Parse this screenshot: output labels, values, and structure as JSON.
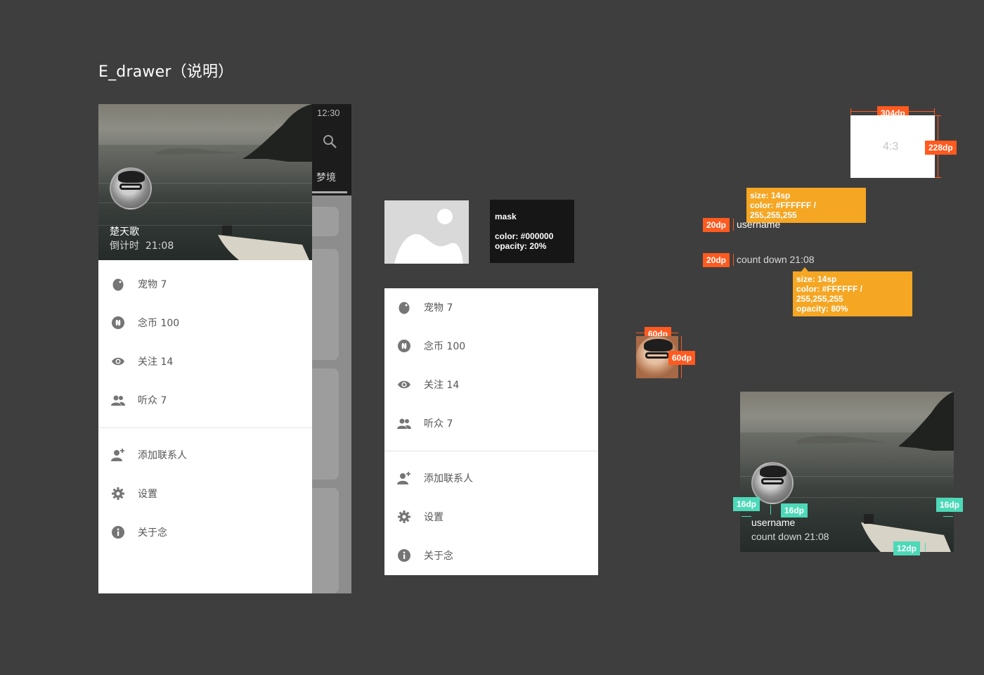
{
  "page": {
    "title": "E_drawer（说明）"
  },
  "drawer": {
    "header": {
      "name": "楚天歌",
      "countdown": "倒计时  21:08"
    },
    "items": [
      {
        "label": "宠物 7",
        "icon": "egg-icon"
      },
      {
        "label": "念币 100",
        "icon": "coin-icon"
      },
      {
        "label": "关注 14",
        "icon": "eye-icon"
      },
      {
        "label": "听众 7",
        "icon": "people-icon"
      }
    ],
    "items2": [
      {
        "label": "添加联系人",
        "icon": "add-person-icon"
      },
      {
        "label": "设置",
        "icon": "gear-icon"
      },
      {
        "label": "关于念",
        "icon": "info-icon"
      }
    ]
  },
  "behind": {
    "time": "12:30",
    "tab": "梦境"
  },
  "mask": {
    "title": "mask",
    "color": "color: #000000",
    "opacity": "opacity: 20%"
  },
  "spec": {
    "width_tag": "304dp",
    "height_tag": "228dp",
    "ratio": "4:3",
    "note_username": [
      "size: 14sp",
      "color: #FFFFFF / 255,255,255"
    ],
    "note_countdown": [
      "size: 14sp",
      "color: #FFFFFF / 255,255,255",
      "opacity: 80%"
    ],
    "tag_20a": "20dp",
    "tag_20b": "20dp",
    "username": "username",
    "countdown": "count down 21:08",
    "avatar_w": "60dp",
    "avatar_h": "60dp",
    "tag16a": "16dp",
    "tag16b": "16dp",
    "tag16c": "16dp",
    "tag12": "12dp",
    "preview_username": "username",
    "preview_countdown": "count down 21:08"
  },
  "colors": {
    "accent": "#ff5a1f",
    "note": "#f5a623",
    "spacing": "#4dd9b8",
    "background": "#3e3e3e"
  }
}
